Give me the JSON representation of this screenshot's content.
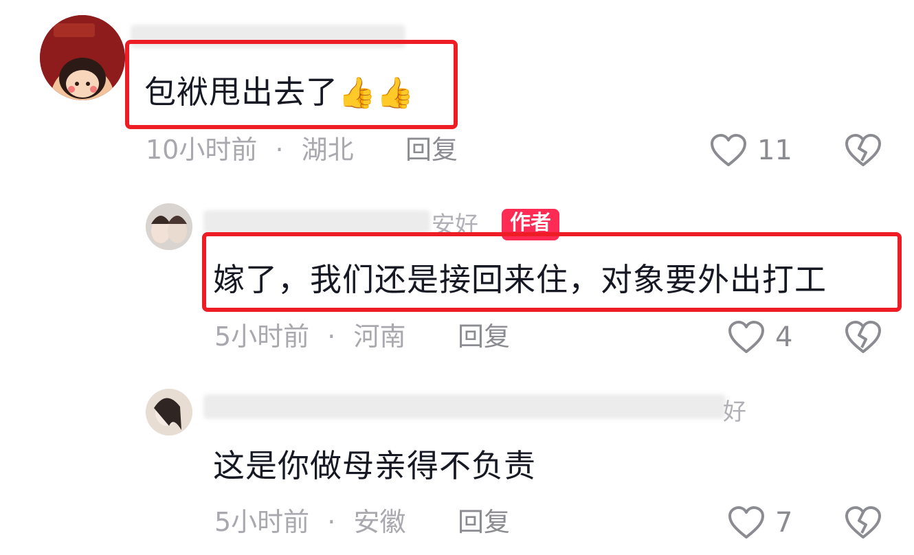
{
  "comments": [
    {
      "text": "包袱甩出去了",
      "emoji": "👍👍",
      "time": "10小时前",
      "sep": "·",
      "location": "湖北",
      "reply_label": "回复",
      "likes": "11"
    },
    {
      "username_visible": "安好",
      "badge": "作者",
      "text": "嫁了，我们还是接回来住，对象要外出打工",
      "time": "5小时前",
      "sep": "·",
      "location": "河南",
      "reply_label": "回复",
      "likes": "4"
    },
    {
      "username_visible": "好",
      "text": "这是你做母亲得不负责",
      "time": "5小时前",
      "sep": "·",
      "location": "安徽",
      "reply_label": "回复",
      "likes": "7"
    }
  ],
  "icons": {
    "like": "heart-outline-icon",
    "dislike": "broken-heart-icon"
  },
  "colors": {
    "highlight": "#ee1c25",
    "badge": "#fe2c55",
    "meta": "#a8a8ae"
  }
}
